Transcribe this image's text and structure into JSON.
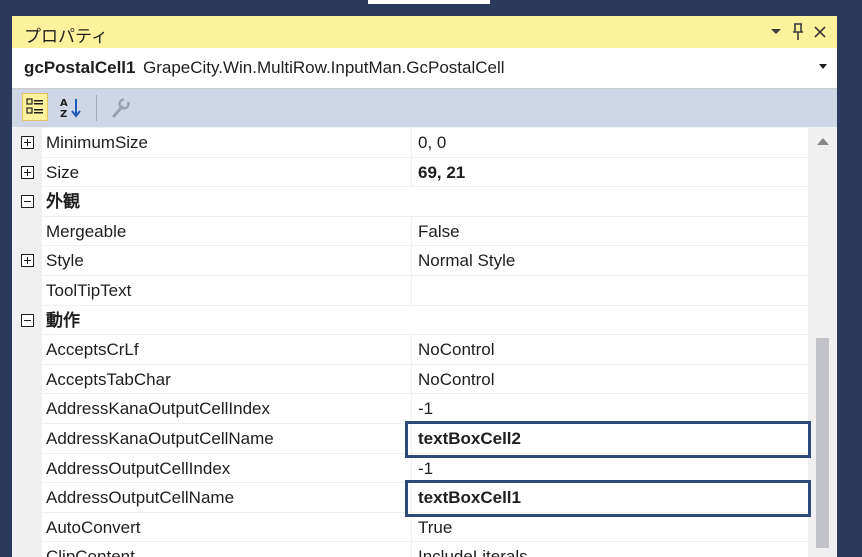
{
  "window": {
    "title": "プロパティ",
    "buttons": {
      "dropdown": "▾",
      "pin": "📌",
      "close": "✕"
    }
  },
  "selector": {
    "object_name": "gcPostalCell1",
    "object_type": "GrapeCity.Win.MultiRow.InputMan.GcPostalCell"
  },
  "toolbar": {
    "categorized_icon": "categorized-icon",
    "alphabetical_icon": "alphabetical-icon",
    "property_pages_icon": "wrench-icon"
  },
  "grid": {
    "rows": [
      {
        "name": "MinimumSize",
        "value": "0, 0",
        "expander": "plus",
        "bold": false
      },
      {
        "name": "Size",
        "value": "69, 21",
        "expander": "plus",
        "bold": true
      },
      {
        "name": "外観",
        "value": "",
        "expander": "minus",
        "category": true
      },
      {
        "name": "Mergeable",
        "value": "False"
      },
      {
        "name": "Style",
        "value": "Normal Style",
        "expander": "plus"
      },
      {
        "name": "ToolTipText",
        "value": ""
      },
      {
        "name": "動作",
        "value": "",
        "expander": "minus",
        "category": true
      },
      {
        "name": "AcceptsCrLf",
        "value": "NoControl"
      },
      {
        "name": "AcceptsTabChar",
        "value": "NoControl"
      },
      {
        "name": "AddressKanaOutputCellIndex",
        "value": "-1"
      },
      {
        "name": "AddressKanaOutputCellName",
        "value": "textBoxCell2",
        "bold": true,
        "highlight": true
      },
      {
        "name": "AddressOutputCellIndex",
        "value": "-1"
      },
      {
        "name": "AddressOutputCellName",
        "value": "textBoxCell1",
        "bold": true,
        "highlight": true
      },
      {
        "name": "AutoConvert",
        "value": "True"
      },
      {
        "name": "ClipContent",
        "value": "IncludeLiterals"
      }
    ]
  },
  "colors": {
    "title_bar": "#fff29d",
    "toolbar": "#cfd6e5",
    "highlight_border": "#2f4a7a",
    "background": "#2b3a5c"
  }
}
